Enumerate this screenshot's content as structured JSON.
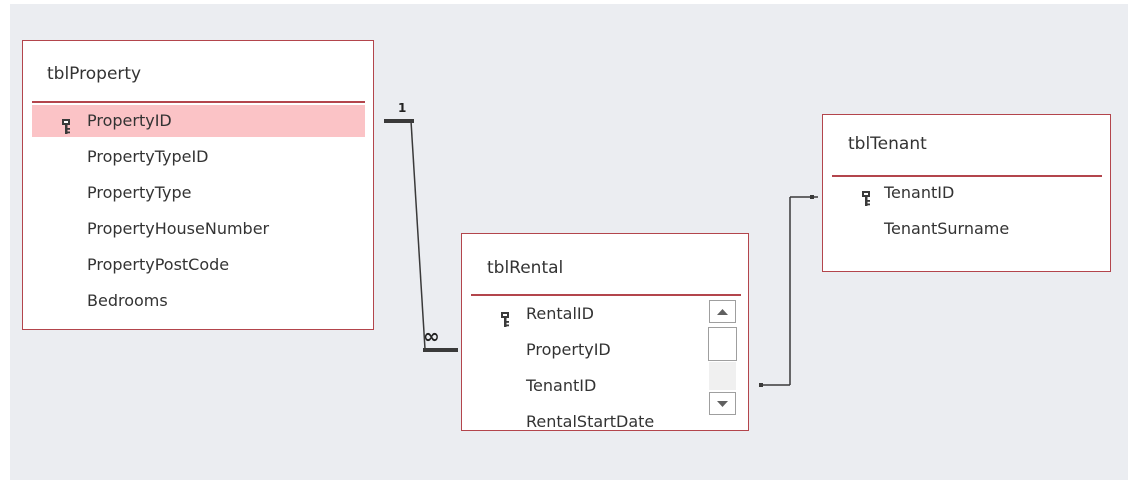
{
  "relationships": {
    "one_label": "1",
    "many_label": "∞"
  },
  "tables": {
    "property": {
      "name": "tblProperty",
      "fields": [
        {
          "name": "PropertyID",
          "key": true,
          "selected": true
        },
        {
          "name": "PropertyTypeID"
        },
        {
          "name": "PropertyType"
        },
        {
          "name": "PropertyHouseNumber"
        },
        {
          "name": "PropertyPostCode"
        },
        {
          "name": "Bedrooms"
        }
      ]
    },
    "rental": {
      "name": "tblRental",
      "fields": [
        {
          "name": "RentalID",
          "key": true
        },
        {
          "name": "PropertyID"
        },
        {
          "name": "TenantID"
        },
        {
          "name": "RentalStartDate"
        }
      ]
    },
    "tenant": {
      "name": "tblTenant",
      "fields": [
        {
          "name": "TenantID",
          "key": true
        },
        {
          "name": "TenantSurname"
        }
      ]
    }
  }
}
